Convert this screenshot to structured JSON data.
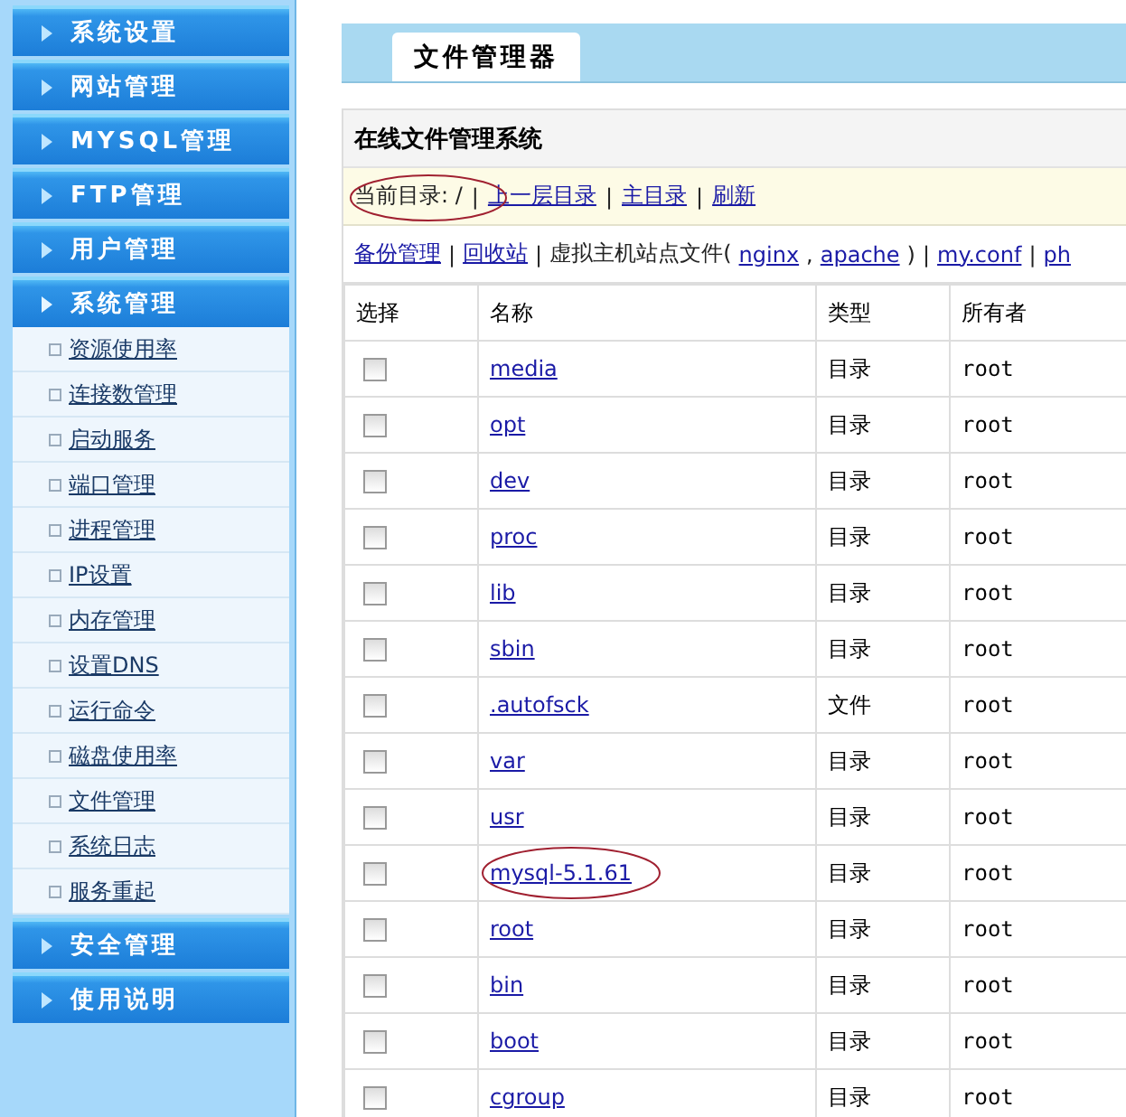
{
  "sidebar": {
    "groups": [
      {
        "label": "系统设置",
        "expanded": false
      },
      {
        "label": "网站管理",
        "expanded": false
      },
      {
        "label": "MYSQL管理",
        "expanded": false
      },
      {
        "label": "FTP管理",
        "expanded": false
      },
      {
        "label": "用户管理",
        "expanded": false
      },
      {
        "label": "系统管理",
        "expanded": true,
        "items": [
          "资源使用率",
          "连接数管理",
          "启动服务",
          "端口管理",
          "进程管理",
          "IP设置",
          "内存管理",
          "设置DNS",
          "运行命令",
          "磁盘使用率",
          "文件管理",
          "系统日志",
          "服务重起"
        ]
      },
      {
        "label": "安全管理",
        "expanded": false
      },
      {
        "label": "使用说明",
        "expanded": false
      }
    ]
  },
  "tabs": [
    {
      "label": "文件管理器",
      "selected": true
    }
  ],
  "panel": {
    "title": "在线文件管理系统",
    "path_bar": {
      "circled": true,
      "segments": [
        {
          "kind": "text",
          "text": "当前目录: /"
        },
        {
          "kind": "sep",
          "text": "|"
        },
        {
          "kind": "link",
          "text": "上一层目录"
        },
        {
          "kind": "sep",
          "text": "|"
        },
        {
          "kind": "link",
          "text": "主目录"
        },
        {
          "kind": "sep",
          "text": "|"
        },
        {
          "kind": "link",
          "text": "刷新"
        }
      ]
    },
    "links": [
      {
        "kind": "link",
        "text": "备份管理"
      },
      {
        "kind": "sep",
        "text": "|"
      },
      {
        "kind": "link",
        "text": "回收站"
      },
      {
        "kind": "sep",
        "text": "|"
      },
      {
        "kind": "text",
        "text": "虚拟主机站点文件("
      },
      {
        "kind": "link",
        "text": "nginx"
      },
      {
        "kind": "text",
        "text": ","
      },
      {
        "kind": "link",
        "text": "apache"
      },
      {
        "kind": "text",
        "text": ")"
      },
      {
        "kind": "sep",
        "text": "|"
      },
      {
        "kind": "link",
        "text": "my.conf"
      },
      {
        "kind": "sep",
        "text": "|"
      },
      {
        "kind": "link",
        "text": "ph"
      }
    ]
  },
  "table": {
    "columns": [
      "选择",
      "名称",
      "类型",
      "所有者"
    ],
    "rows": [
      {
        "checked": false,
        "name": "media",
        "type": "目录",
        "owner": "root",
        "circled": false
      },
      {
        "checked": false,
        "name": "opt",
        "type": "目录",
        "owner": "root",
        "circled": false
      },
      {
        "checked": false,
        "name": "dev",
        "type": "目录",
        "owner": "root",
        "circled": false
      },
      {
        "checked": false,
        "name": "proc",
        "type": "目录",
        "owner": "root",
        "circled": false
      },
      {
        "checked": false,
        "name": "lib",
        "type": "目录",
        "owner": "root",
        "circled": false
      },
      {
        "checked": false,
        "name": "sbin",
        "type": "目录",
        "owner": "root",
        "circled": false
      },
      {
        "checked": false,
        "name": ".autofsck",
        "type": "文件",
        "owner": "root",
        "circled": false
      },
      {
        "checked": false,
        "name": "var",
        "type": "目录",
        "owner": "root",
        "circled": false
      },
      {
        "checked": false,
        "name": "usr",
        "type": "目录",
        "owner": "root",
        "circled": false
      },
      {
        "checked": false,
        "name": "mysql-5.1.61",
        "type": "目录",
        "owner": "root",
        "circled": true
      },
      {
        "checked": false,
        "name": "root",
        "type": "目录",
        "owner": "root",
        "circled": false
      },
      {
        "checked": false,
        "name": "bin",
        "type": "目录",
        "owner": "root",
        "circled": false
      },
      {
        "checked": false,
        "name": "boot",
        "type": "目录",
        "owner": "root",
        "circled": false
      },
      {
        "checked": false,
        "name": "cgroup",
        "type": "目录",
        "owner": "root",
        "circled": false
      }
    ]
  }
}
